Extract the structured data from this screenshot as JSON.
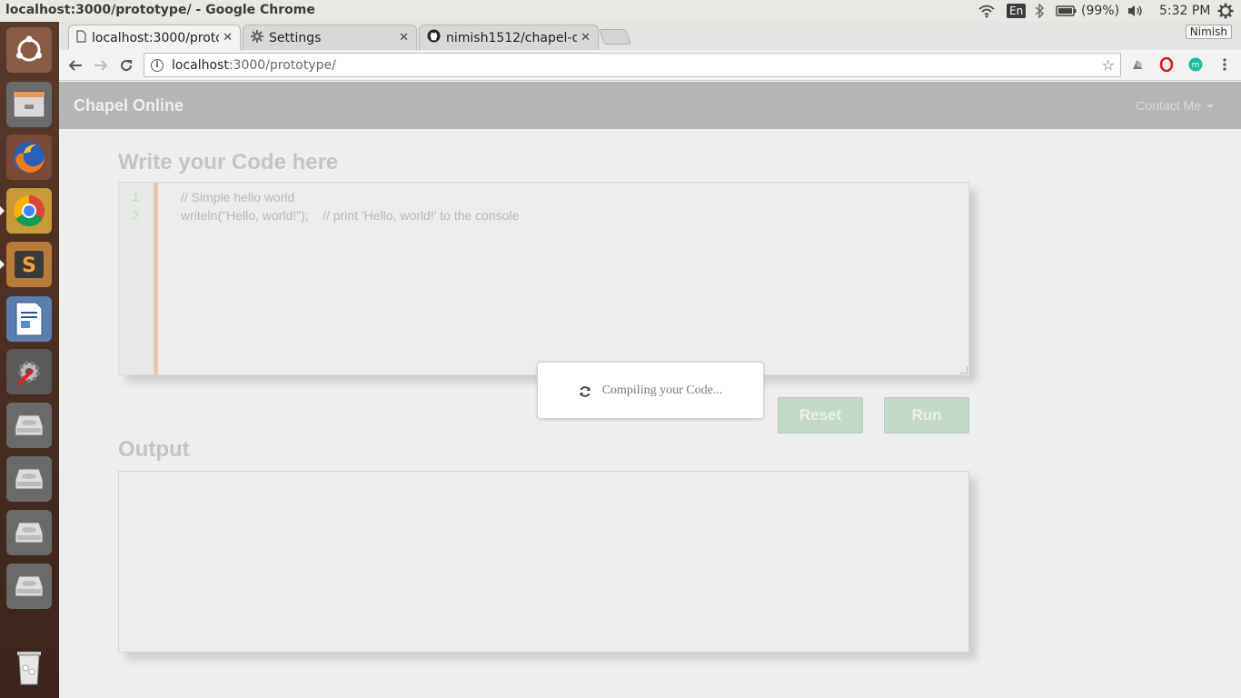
{
  "window": {
    "title": "localhost:3000/prototype/ - Google Chrome"
  },
  "system_tray": {
    "language": "En",
    "battery": "(99%)",
    "time": "5:32 PM"
  },
  "launcher": {
    "items": [
      {
        "name": "ubuntu-dash-icon"
      },
      {
        "name": "files-icon"
      },
      {
        "name": "firefox-icon"
      },
      {
        "name": "chrome-icon"
      },
      {
        "name": "sublime-text-icon"
      },
      {
        "name": "libreoffice-writer-icon"
      },
      {
        "name": "system-settings-icon"
      },
      {
        "name": "drive-icon"
      },
      {
        "name": "drive-icon"
      },
      {
        "name": "drive-icon"
      },
      {
        "name": "drive-icon"
      },
      {
        "name": "trash-icon"
      }
    ]
  },
  "browser": {
    "tabs": [
      {
        "label": "localhost:3000/prototype/",
        "icon": "page-icon",
        "active": true
      },
      {
        "label": "Settings",
        "icon": "gear-icon",
        "active": false
      },
      {
        "label": "nimish1512/chapel-online",
        "icon": "github-icon",
        "active": false
      }
    ],
    "profile_name": "Nimish",
    "url_host": "localhost",
    "url_rest": ":3000/prototype/"
  },
  "app": {
    "brand": "Chapel Online",
    "contact_menu": "Contact Me",
    "code_heading": "Write your Code here",
    "code_lines": [
      {
        "num": "1",
        "text": "// Simple hello world"
      },
      {
        "num": "2",
        "text": "writeln(\"Hello, world!\");    // print 'Hello, world!' to the console"
      }
    ],
    "reset_label": "Reset",
    "run_label": "Run",
    "output_heading": "Output",
    "output_text": "",
    "loader_text": "Compiling your Code..."
  },
  "colors": {
    "navbar": "#b5b5b5",
    "button_bg": "#c4dac8",
    "gutter_bar": "#efc5b2"
  }
}
